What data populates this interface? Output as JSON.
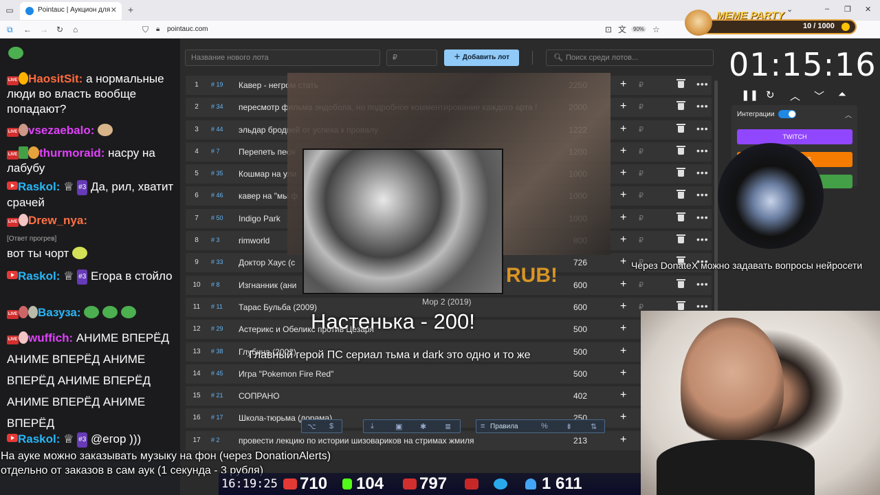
{
  "browser": {
    "tab_title": "Pointauc | Аукцион для стримеров",
    "url": "pointauc.com",
    "zoom": "90%"
  },
  "app": {
    "new_lot_placeholder": "Название нового лота",
    "currency_placeholder": "₽",
    "add_lot_label": "Добавить лот",
    "search_placeholder": "Поиск среди лотов...",
    "timer": "01:15:16",
    "integrations_label": "Интеграции",
    "integration_buttons": [
      "TWITCH",
      "ERTS",
      ""
    ],
    "rules_label": "Правила",
    "lots": [
      {
        "idx": "1",
        "code": "# 19",
        "name": "Кавер - негром стать",
        "amount": "2250"
      },
      {
        "idx": "2",
        "code": "# 34",
        "name": "пересмотр фильма эндобола, но подробное комментирование каждого арта !",
        "amount": "2000"
      },
      {
        "idx": "3",
        "code": "# 44",
        "name": "эльдар бродвей от успеха к провалу",
        "amount": "1222"
      },
      {
        "idx": "4",
        "code": "# 7",
        "name": "Перепеть песн",
        "amount": "1200"
      },
      {
        "idx": "5",
        "code": "# 35",
        "name": "Кошмар на ули",
        "amount": "1000"
      },
      {
        "idx": "6",
        "code": "# 46",
        "name": "кавер на \"мы ф",
        "amount": "1000"
      },
      {
        "idx": "7",
        "code": "# 50",
        "name": "Indigo Park",
        "amount": "1000"
      },
      {
        "idx": "8",
        "code": "# 3",
        "name": "rimworld",
        "amount": "800"
      },
      {
        "idx": "9",
        "code": "# 33",
        "name": "Доктор Хаус (с",
        "amount": "726"
      },
      {
        "idx": "10",
        "code": "# 8",
        "name": "Изгнанник (ани",
        "amount": "600"
      },
      {
        "idx": "11",
        "code": "# 11",
        "name": "Тарас Бульба (2009)",
        "amount": "600"
      },
      {
        "idx": "12",
        "code": "# 29",
        "name": "Астерикс и Обеликс против Цезаря",
        "amount": "500"
      },
      {
        "idx": "13",
        "code": "# 38",
        "name": "Глубина (2002)",
        "amount": "500"
      },
      {
        "idx": "14",
        "code": "# 45",
        "name": "Игра \"Pokemon Fire Red\"",
        "amount": "500"
      },
      {
        "idx": "15",
        "code": "# 21",
        "name": "СОПРАНО",
        "amount": "402"
      },
      {
        "idx": "16",
        "code": "# 17",
        "name": "Школа-тюрьма (дорама)",
        "amount": "250"
      },
      {
        "idx": "17",
        "code": "# 2",
        "name": "провести лекцию по истории шизовариков на стримах жмиля",
        "amount": "213"
      }
    ]
  },
  "chat": {
    "messages": [
      {
        "user": "HaositSit:",
        "color": "#ff6b3d",
        "text": "а нормальные люди во власть вообще попадают?",
        "badge": ""
      },
      {
        "user": "vsezaebalo:",
        "color": "#e040fb",
        "text": "",
        "badge": ""
      },
      {
        "user": "thurmoraid:",
        "color": "#e040fb",
        "text": "насру на лабубу",
        "badge": ""
      },
      {
        "user": "Raskol:",
        "color": "#29b6f6",
        "text": "Да, рил, хватит срачей",
        "badge": "#3"
      },
      {
        "user": "Drew_nya:",
        "color": "#ff7043",
        "text": "",
        "badge": ""
      },
      {
        "reply": "[Ответ прогрев]"
      },
      {
        "user": "",
        "color": "#fff",
        "text": "вот ты чорт",
        "badge": ""
      },
      {
        "user": "Raskol:",
        "color": "#29b6f6",
        "text": "Егора в стойло",
        "badge": "#3"
      },
      {
        "user": "Вазуза:",
        "color": "#29b6f6",
        "text": "",
        "badge": ""
      },
      {
        "user": "wuffich:",
        "color": "#e040fb",
        "text": "АНИМЕ ВПЕРЁД АНИМЕ ВПЕРЁД АНИМЕ ВПЕРЁД АНИМЕ ВПЕРЁД АНИМЕ ВПЕРЁД АНИМЕ ВПЕРЁД",
        "badge": ""
      },
      {
        "user": "Raskol:",
        "color": "#29b6f6",
        "text": "@егор )))",
        "badge": "#3"
      }
    ]
  },
  "overlays": {
    "video_caption": "Мор 2 (2019)",
    "rub_text": "RUB!",
    "donation_alert": "Настенька - 200!",
    "donation_message": "Главный герой ПС сериал тьма и dark это одно и то же",
    "donatex_ticker": "Через DonateX можно задавать вопросы нейросети",
    "subtitle_line1": "На ауке можно заказывать музыку на фон (через DonationAlerts)",
    "subtitle_line2": "отдельно от заказов в сам аук (1 секунда - 3 рубля)",
    "meme_title": "MEME PARTY",
    "meme_count": "10 / 1000",
    "meme_progress": 0.01
  },
  "stats": {
    "time": "16:19:25",
    "youtube": "710",
    "kick": "104",
    "vk": "797",
    "telegram": "",
    "viewers": "1 611"
  },
  "colors": {
    "accent": "#90caf9",
    "twitch": "#9146ff",
    "alerts": "#f57c00",
    "green": "#43a047",
    "amount_code": "#64b5f6"
  }
}
